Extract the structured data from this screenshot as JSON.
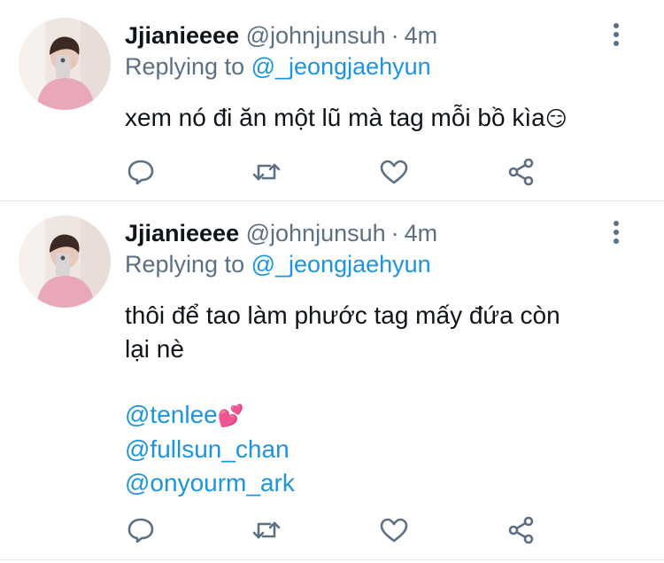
{
  "tweets": [
    {
      "name": "Jjianieeee",
      "handle": "@johnjunsuh",
      "separator": "·",
      "time": "4m",
      "replying_prefix": "Replying to",
      "replying_handle": "@_jeongjaehyun",
      "text": "xem nó đi ăn một lũ mà tag mỗi bồ kìa",
      "text_emoji": "😏",
      "icons": [
        "reply-icon",
        "retweet-icon",
        "like-icon",
        "share-icon"
      ]
    },
    {
      "name": "Jjianieeee",
      "handle": "@johnjunsuh",
      "separator": "·",
      "time": "4m",
      "replying_prefix": "Replying to",
      "replying_handle": "@_jeongjaehyun",
      "text_line1": "thôi để tao làm phước tag mấy đứa còn",
      "text_line2": "lại nè",
      "mentions": [
        {
          "handle": "@tenlee",
          "emoji": "💕"
        },
        {
          "handle": "@fullsun_chan",
          "emoji": ""
        },
        {
          "handle": "@onyourm_ark",
          "emoji": ""
        }
      ],
      "icons": [
        "reply-icon",
        "retweet-icon",
        "like-icon",
        "share-icon"
      ]
    }
  ],
  "colors": {
    "link": "#1b95e0",
    "secondary": "#5b7083",
    "text": "#0f1419",
    "divider": "#e3e6e8"
  }
}
